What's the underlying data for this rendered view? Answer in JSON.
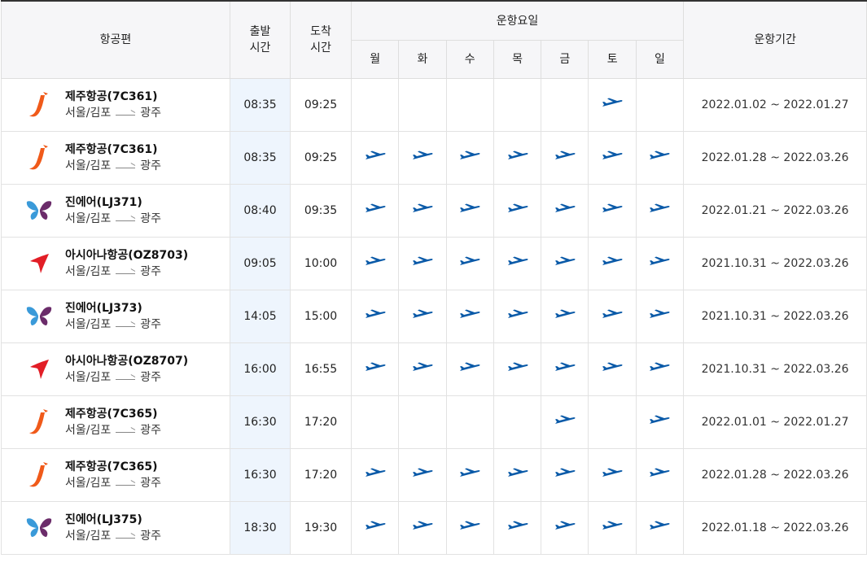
{
  "header": {
    "flight": "항공편",
    "dep": [
      "출발",
      "시간"
    ],
    "arr": [
      "도착",
      "시간"
    ],
    "days_group": "운항요일",
    "days": [
      "월",
      "화",
      "수",
      "목",
      "금",
      "토",
      "일"
    ],
    "period": "운항기간"
  },
  "flights": [
    {
      "airline": "jeju",
      "name": "제주항공(7C361)",
      "from": "서울/김포",
      "to": "광주",
      "dep": "08:35",
      "arr": "09:25",
      "days": [
        false,
        false,
        false,
        false,
        false,
        true,
        false
      ],
      "period": "2022.01.02 ~ 2022.01.27"
    },
    {
      "airline": "jeju",
      "name": "제주항공(7C361)",
      "from": "서울/김포",
      "to": "광주",
      "dep": "08:35",
      "arr": "09:25",
      "days": [
        true,
        true,
        true,
        true,
        true,
        true,
        true
      ],
      "period": "2022.01.28 ~ 2022.03.26"
    },
    {
      "airline": "jinair",
      "name": "진에어(LJ371)",
      "from": "서울/김포",
      "to": "광주",
      "dep": "08:40",
      "arr": "09:35",
      "days": [
        true,
        true,
        true,
        true,
        true,
        true,
        true
      ],
      "period": "2022.01.21 ~ 2022.03.26"
    },
    {
      "airline": "asiana",
      "name": "아시아나항공(OZ8703)",
      "from": "서울/김포",
      "to": "광주",
      "dep": "09:05",
      "arr": "10:00",
      "days": [
        true,
        true,
        true,
        true,
        true,
        true,
        true
      ],
      "period": "2021.10.31 ~ 2022.03.26"
    },
    {
      "airline": "jinair",
      "name": "진에어(LJ373)",
      "from": "서울/김포",
      "to": "광주",
      "dep": "14:05",
      "arr": "15:00",
      "days": [
        true,
        true,
        true,
        true,
        true,
        true,
        true
      ],
      "period": "2021.10.31 ~ 2022.03.26"
    },
    {
      "airline": "asiana",
      "name": "아시아나항공(OZ8707)",
      "from": "서울/김포",
      "to": "광주",
      "dep": "16:00",
      "arr": "16:55",
      "days": [
        true,
        true,
        true,
        true,
        true,
        true,
        true
      ],
      "period": "2021.10.31 ~ 2022.03.26"
    },
    {
      "airline": "jeju",
      "name": "제주항공(7C365)",
      "from": "서울/김포",
      "to": "광주",
      "dep": "16:30",
      "arr": "17:20",
      "days": [
        false,
        false,
        false,
        false,
        true,
        false,
        true
      ],
      "period": "2022.01.01 ~ 2022.01.27"
    },
    {
      "airline": "jeju",
      "name": "제주항공(7C365)",
      "from": "서울/김포",
      "to": "광주",
      "dep": "16:30",
      "arr": "17:20",
      "days": [
        true,
        true,
        true,
        true,
        true,
        true,
        true
      ],
      "period": "2022.01.28 ~ 2022.03.26"
    },
    {
      "airline": "jinair",
      "name": "진에어(LJ375)",
      "from": "서울/김포",
      "to": "광주",
      "dep": "18:30",
      "arr": "19:30",
      "days": [
        true,
        true,
        true,
        true,
        true,
        true,
        true
      ],
      "period": "2022.01.18 ~ 2022.03.26"
    }
  ],
  "icons": {
    "operating_day": "airplane-icon",
    "route_arrow": "arrow-right-icon",
    "jeju": "jeju-air-logo",
    "jinair": "jin-air-logo",
    "asiana": "asiana-logo"
  },
  "colors": {
    "plane": "#0a5aa8",
    "dep_column_bg": "#eef5fd",
    "header_bg": "#f6f6f8",
    "jeju": "#f05a1a",
    "jinair_blue": "#3a9ad9",
    "jinair_purple": "#6b2c6a",
    "asiana": "#e21e26"
  }
}
